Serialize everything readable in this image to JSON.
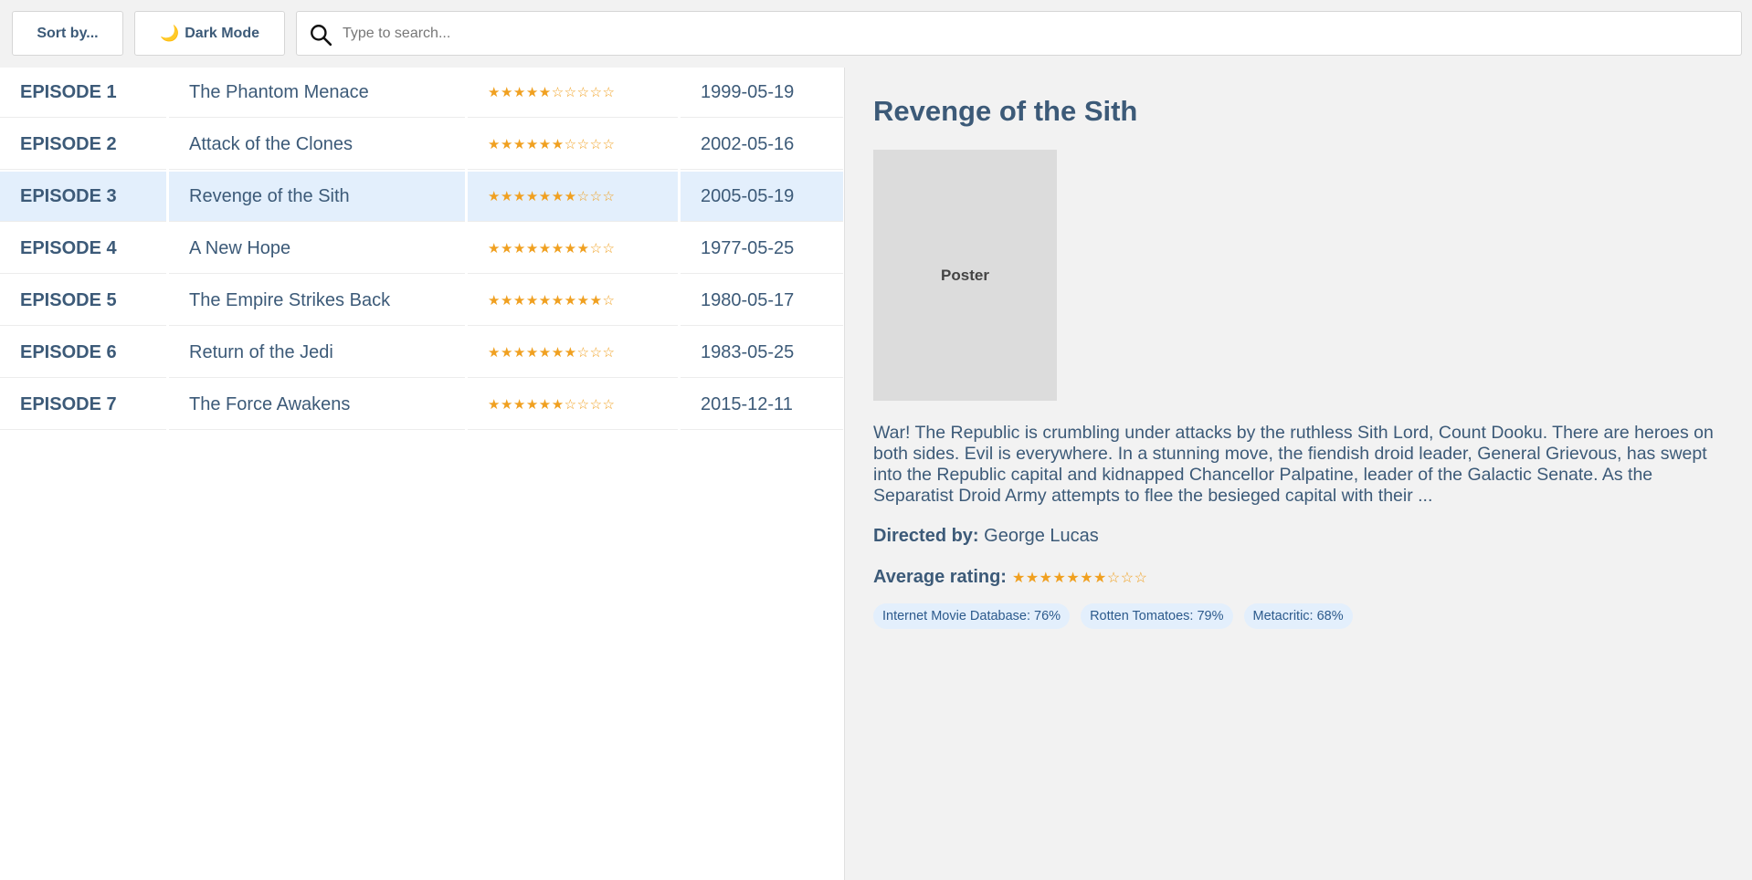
{
  "toolbar": {
    "sort_label": "Sort by...",
    "dark_mode_label": "Dark Mode",
    "search_placeholder": "Type to search..."
  },
  "episodes": [
    {
      "episode": "EPISODE 1",
      "title": "The Phantom Menace",
      "stars": "★★★★★☆☆☆☆☆",
      "date": "1999-05-19",
      "rating": 5
    },
    {
      "episode": "EPISODE 2",
      "title": "Attack of the Clones",
      "stars": "★★★★★★☆☆☆☆",
      "date": "2002-05-16",
      "rating": 6
    },
    {
      "episode": "EPISODE 3",
      "title": "Revenge of the Sith",
      "stars": "★★★★★★★☆☆☆",
      "date": "2005-05-19",
      "rating": 7
    },
    {
      "episode": "EPISODE 4",
      "title": "A New Hope",
      "stars": "★★★★★★★★☆☆",
      "date": "1977-05-25",
      "rating": 8
    },
    {
      "episode": "EPISODE 5",
      "title": "The Empire Strikes Back",
      "stars": "★★★★★★★★★☆",
      "date": "1980-05-17",
      "rating": 9
    },
    {
      "episode": "EPISODE 6",
      "title": "Return of the Jedi",
      "stars": "★★★★★★★☆☆☆",
      "date": "1983-05-25",
      "rating": 7
    },
    {
      "episode": "EPISODE 7",
      "title": "The Force Awakens",
      "stars": "★★★★★★☆☆☆☆",
      "date": "2015-12-11",
      "rating": 6
    }
  ],
  "selected_index": 2,
  "detail": {
    "title": "Revenge of the Sith",
    "poster_label": "Poster",
    "synopsis": "War! The Republic is crumbling under attacks by the ruthless Sith Lord, Count Dooku. There are heroes on both sides. Evil is everywhere. In a stunning move, the fiendish droid leader, General Grievous, has swept into the Republic capital and kidnapped Chancellor Palpatine, leader of the Galactic Senate. As the Separatist Droid Army attempts to flee the besieged capital with their ...",
    "directed_label": "Directed by:",
    "director": "George Lucas",
    "avg_label": "Average rating:",
    "avg_stars": "★★★★★★★☆☆☆",
    "avg_rating": 7,
    "ratings": [
      "Internet Movie Database: 76%",
      "Rotten Tomatoes: 79%",
      "Metacritic: 68%"
    ]
  },
  "colors": {
    "accent_text": "#3c5a78",
    "star": "#f0a020",
    "selected_row": "#e3effc",
    "badge_bg": "#e3effc"
  }
}
